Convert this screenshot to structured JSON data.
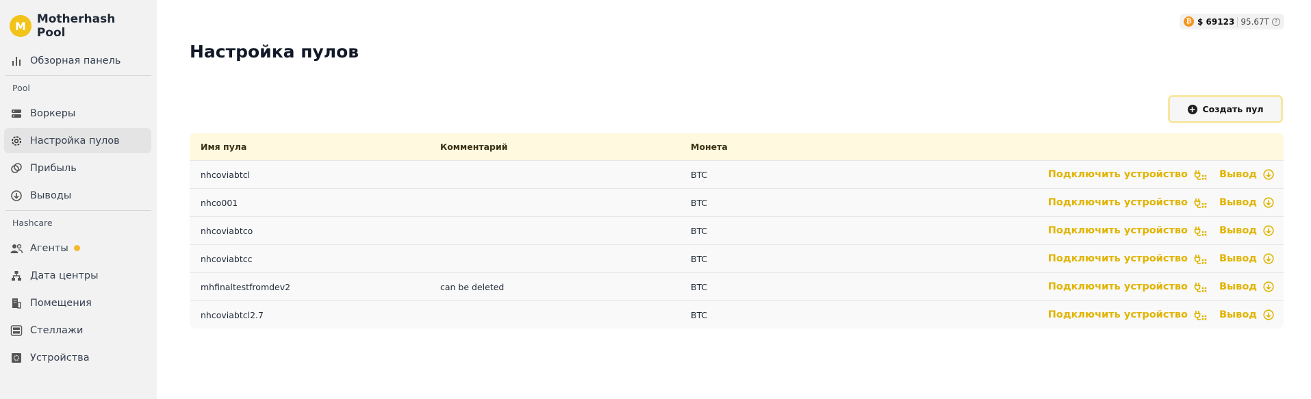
{
  "brand": {
    "name": "Motherhash Pool",
    "logo_text": "M",
    "color": "#f2c318"
  },
  "nav": {
    "dashboard": "Обзорная панель",
    "section_pool": "Pool",
    "workers": "Воркеры",
    "pool_settings": "Настройка пулов",
    "profit": "Прибыль",
    "withdrawals": "Выводы",
    "section_hashcare": "Hashcare",
    "agents": "Агенты",
    "datacenters": "Дата центры",
    "rooms": "Помещения",
    "racks": "Стеллажи",
    "devices": "Устройства"
  },
  "ticker": {
    "btc_symbol": "₿",
    "price": "$ 69123",
    "hashrate": "95.67T",
    "help": "?"
  },
  "page": {
    "title": "Настройка пулов",
    "create_button": "Создать пул"
  },
  "table": {
    "headers": {
      "name": "Имя пула",
      "comment": "Комментарий",
      "coin": "Монета"
    },
    "action_connect": "Подключить устройство",
    "action_withdraw": "Вывод",
    "rows": [
      {
        "name": "nhcoviabtcl",
        "comment": "",
        "coin": "BTC"
      },
      {
        "name": "nhco001",
        "comment": "",
        "coin": "BTC"
      },
      {
        "name": "nhcoviabtco",
        "comment": "",
        "coin": "BTC"
      },
      {
        "name": "nhcoviabtcc",
        "comment": "",
        "coin": "BTC"
      },
      {
        "name": "mhfinaltestfromdev2",
        "comment": "can be deleted",
        "coin": "BTC"
      },
      {
        "name": "nhcoviabtcl2.7",
        "comment": "",
        "coin": "BTC"
      }
    ]
  },
  "colors": {
    "accent": "#e0b400",
    "header_bg": "#fff9df",
    "sidebar_bg": "#f2f2f2",
    "agent_dot": "#f5b82e"
  }
}
